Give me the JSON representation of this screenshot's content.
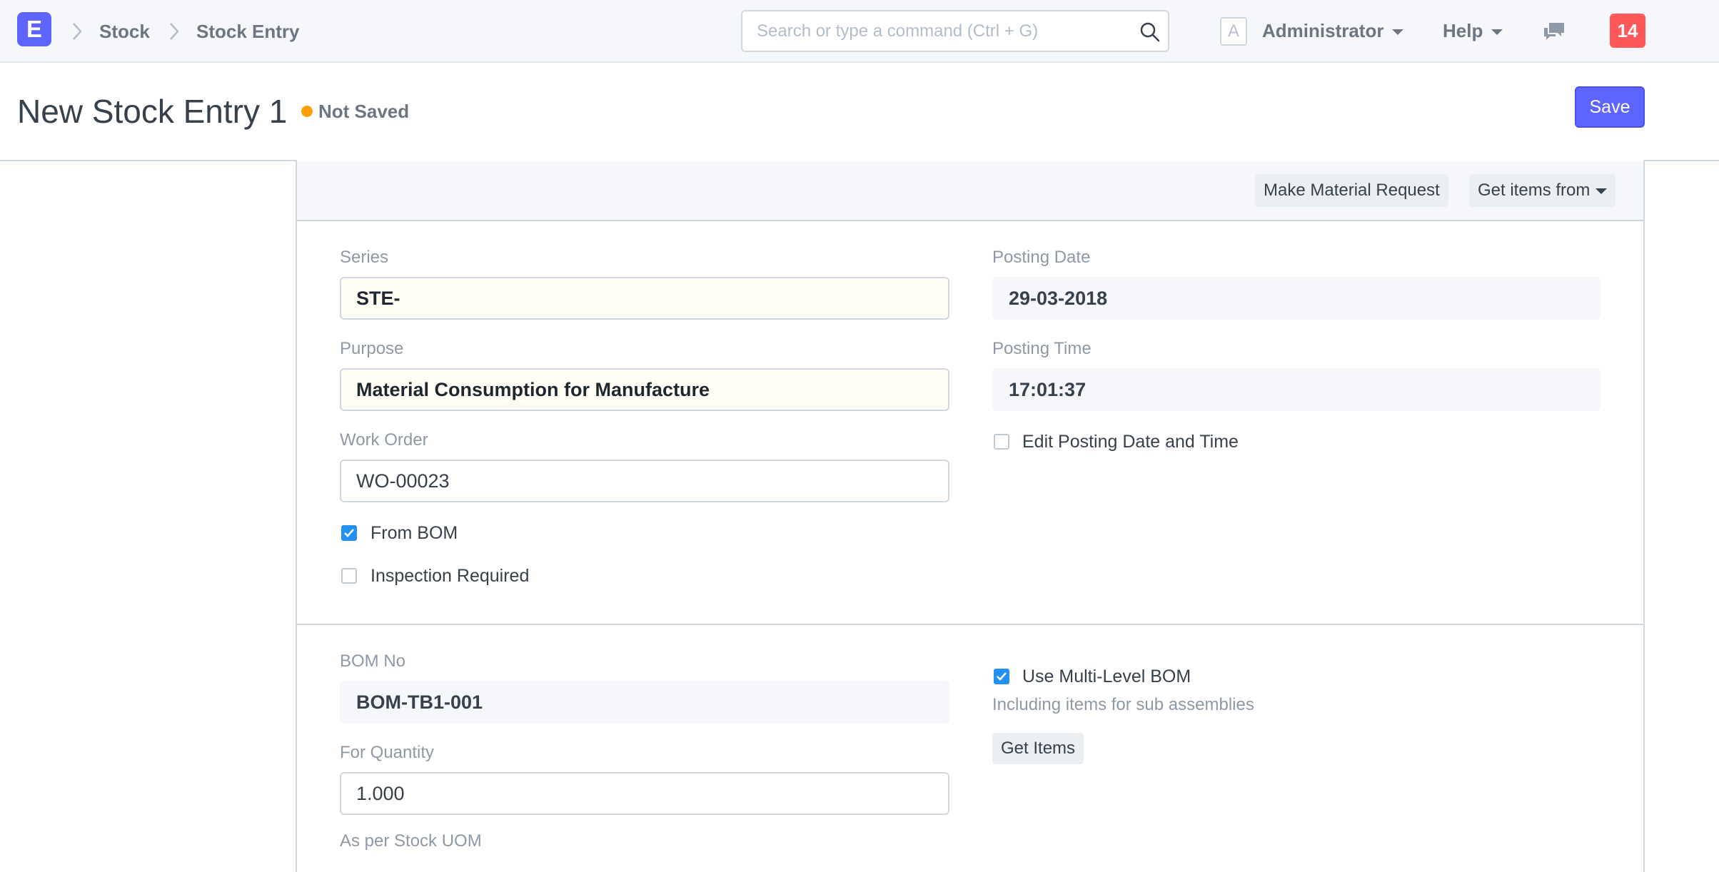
{
  "navbar": {
    "logo_letter": "E",
    "breadcrumbs": [
      "Stock",
      "Stock Entry"
    ],
    "search": {
      "placeholder": "Search or type a command (Ctrl + G)"
    },
    "avatar_letter": "A",
    "user_menu": "Administrator",
    "help_menu": "Help",
    "notification_count": "14"
  },
  "page_header": {
    "title": "New Stock Entry 1",
    "status": "Not Saved",
    "save_label": "Save"
  },
  "toolbar": {
    "make_material_request": "Make Material Request",
    "get_items_from": "Get items from"
  },
  "form": {
    "series": {
      "label": "Series",
      "value": "STE-"
    },
    "purpose": {
      "label": "Purpose",
      "value": "Material Consumption for Manufacture"
    },
    "work_order": {
      "label": "Work Order",
      "value": "WO-00023"
    },
    "from_bom": {
      "label": "From BOM",
      "checked": true
    },
    "inspection_required": {
      "label": "Inspection Required",
      "checked": false
    },
    "posting_date": {
      "label": "Posting Date",
      "value": "29-03-2018"
    },
    "posting_time": {
      "label": "Posting Time",
      "value": "17:01:37"
    },
    "edit_posting": {
      "label": "Edit Posting Date and Time",
      "checked": false
    },
    "bom_no": {
      "label": "BOM No",
      "value": "BOM-TB1-001"
    },
    "for_quantity": {
      "label": "For Quantity",
      "value": "1.000",
      "help": "As per Stock UOM"
    },
    "use_multi_level_bom": {
      "label": "Use Multi-Level BOM",
      "checked": true,
      "help": "Including items for sub assemblies"
    },
    "get_items_label": "Get Items"
  },
  "colors": {
    "primary": "#5e64ff",
    "checkbox_on": "#2490ef",
    "status_dot": "#ffa00a",
    "notification": "#ff5858"
  }
}
